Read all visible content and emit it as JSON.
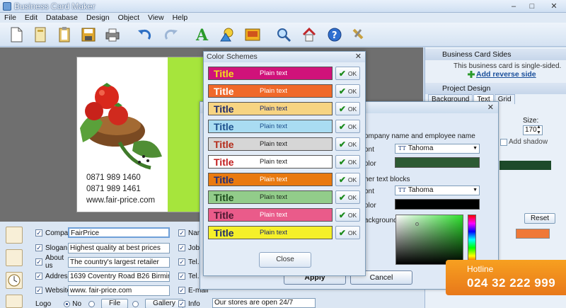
{
  "window": {
    "title": "Business Card Maker",
    "controls": {
      "minimize": "–",
      "maximize": "□",
      "close": "✕"
    }
  },
  "menu": [
    "File",
    "Edit",
    "Database",
    "Design",
    "Object",
    "View",
    "Help"
  ],
  "toolbar": {
    "icons": [
      "new-icon",
      "open-icon",
      "clipboard-icon",
      "save-icon",
      "print-icon",
      "undo-icon",
      "redo-icon",
      "text-icon",
      "shape-icon",
      "image-icon",
      "zoom-icon",
      "home-icon",
      "help-icon",
      "tools-icon"
    ]
  },
  "card": {
    "phone1": "0871 989 1460",
    "phone2": "0871 989 1461",
    "website": "www.fair-price.com",
    "accent_color": "#a6e53c"
  },
  "right_panel": {
    "sides_title": "Business Card Sides",
    "sides_text": "This business card is single-sided.",
    "add_reverse": "Add reverse side",
    "design_title": "Project Design",
    "tabs": [
      "Background",
      "Text",
      "Grid"
    ],
    "active_tab": "Text",
    "size_label": "Size:",
    "size_value": "170",
    "add_shadow": "Add shadow",
    "reset": "Reset"
  },
  "fields": {
    "rows": [
      {
        "label": "Company",
        "value": "FairPrice",
        "checked": true
      },
      {
        "label": "Slogan",
        "value": "Highest quality at best prices",
        "checked": true
      },
      {
        "label": "About us",
        "value": "The country's largest retailer",
        "checked": true
      },
      {
        "label": "Address",
        "value": "1639 Coventry Road B26 Birmingham",
        "checked": true
      },
      {
        "label": "Website",
        "value": "www. fair-price.com",
        "checked": true
      }
    ],
    "right_rows": [
      "Name",
      "Job Tit",
      "Tel. 1",
      "Tel. 2",
      "E-mail",
      "Info"
    ],
    "logo_label": "Logo",
    "logo_no": "No",
    "file_button": "File",
    "gallery_button": "Gallery",
    "stores_value": "Our stores are open 24/7"
  },
  "text_dialog": {
    "section1": "ompany name and employee name",
    "font_label": "ont",
    "color_label": "olor",
    "font1": "Tahoma",
    "color1": "#2d5a33",
    "section2": "her text blocks",
    "font2": "Tahoma",
    "color2": "#000000",
    "background_label": "ackground",
    "apply": "Apply",
    "cancel": "Cancel"
  },
  "color_schemes": {
    "title": "Color Schemes",
    "close_button": "Close",
    "ok_label": "OK",
    "schemes": [
      {
        "title": "Title",
        "plain": "Plain text",
        "bg": "#d0127a",
        "title_color": "#f2e21a",
        "plain_color": "#ffffff"
      },
      {
        "title": "Title",
        "plain": "Plain text",
        "bg": "#f0692a",
        "title_color": "#ffffff",
        "plain_color": "#ffffff"
      },
      {
        "title": "Title",
        "plain": "Plain text",
        "bg": "#f7d482",
        "title_color": "#1c2a6b",
        "plain_color": "#1c2a6b"
      },
      {
        "title": "Title",
        "plain": "Plain text",
        "bg": "#a9dcf2",
        "title_color": "#1c4f8c",
        "plain_color": "#1c4f8c"
      },
      {
        "title": "Title",
        "plain": "Plain text",
        "bg": "#d6d6d6",
        "title_color": "#b42a18",
        "plain_color": "#222222"
      },
      {
        "title": "Title",
        "plain": "Plain text",
        "bg": "#ffffff",
        "title_color": "#c21d1d",
        "plain_color": "#222222"
      },
      {
        "title": "Title",
        "plain": "Plain text",
        "bg": "#e97a10",
        "title_color": "#1f2e78",
        "plain_color": "#ffffff"
      },
      {
        "title": "Title",
        "plain": "Plain text",
        "bg": "#92cc8a",
        "title_color": "#1d4a1d",
        "plain_color": "#1d2a1d"
      },
      {
        "title": "Title",
        "plain": "Plain text",
        "bg": "#ea5b8a",
        "title_color": "#4a1630",
        "plain_color": "#ffffff"
      },
      {
        "title": "Title",
        "plain": "Plain text",
        "bg": "#f5f02a",
        "title_color": "#1c2a6b",
        "plain_color": "#1c2a6b"
      }
    ]
  },
  "hotline": {
    "label": "Hotline",
    "number": "024 32 222 999"
  }
}
